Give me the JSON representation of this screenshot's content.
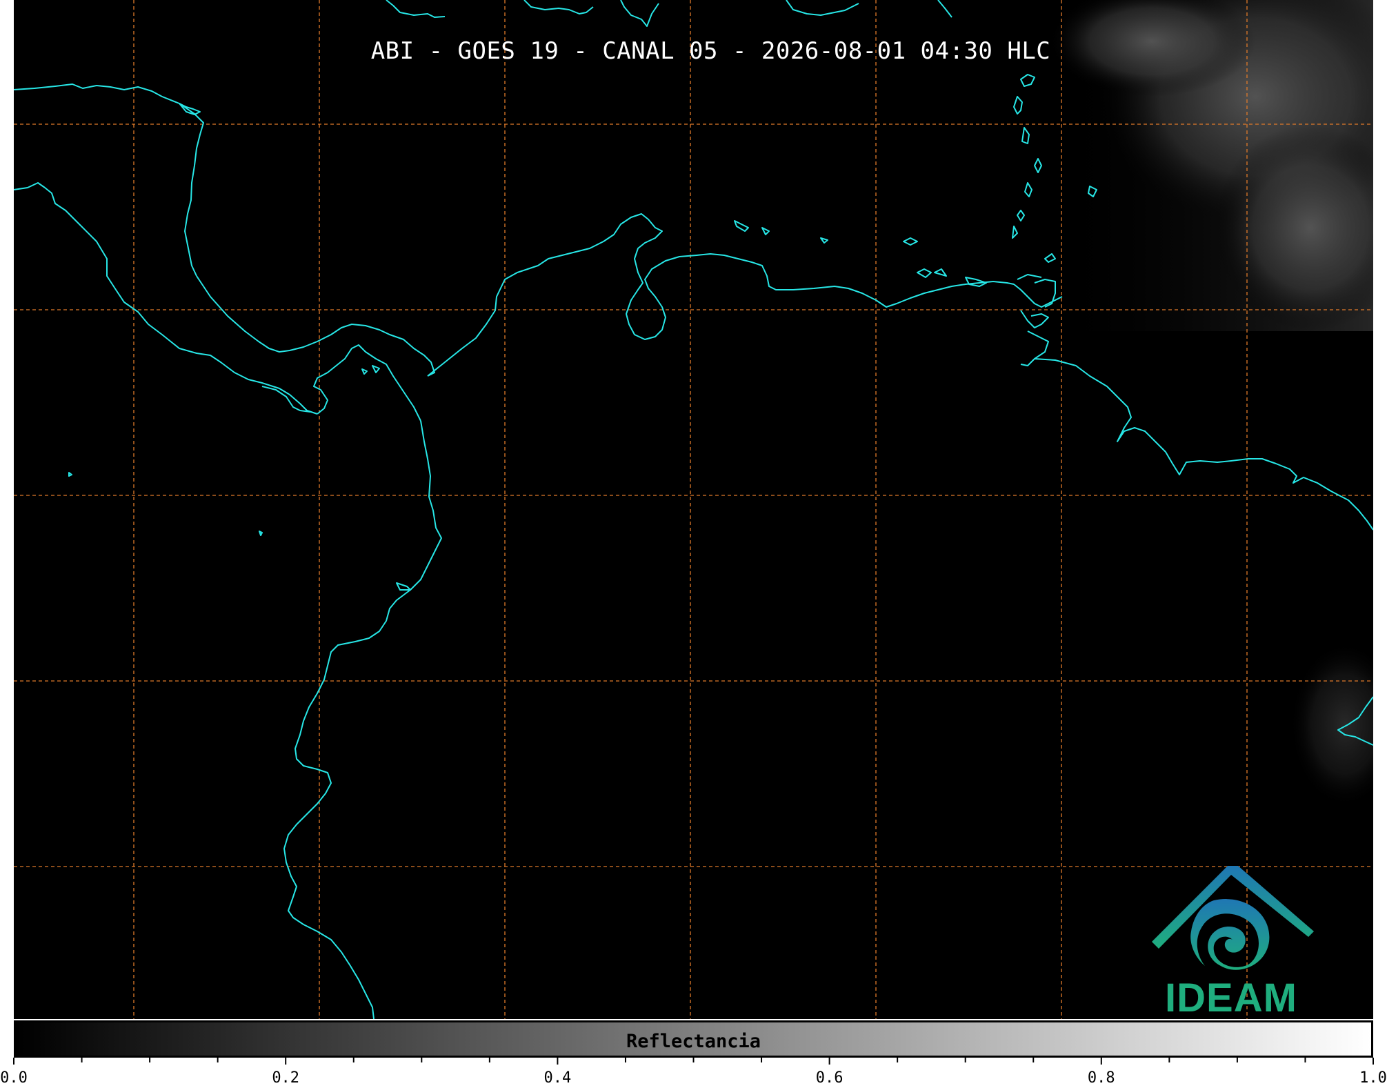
{
  "map": {
    "title": "ABI - GOES 19 - CANAL 05 - 2026-08-01 04:30 HLC",
    "background_color": "#000000",
    "coastline_color": "#27e6e6",
    "gridline_color": "#e07a2a",
    "grid": true,
    "logo": {
      "text": "IDEAM",
      "icon": "ideam-logo-icon",
      "colors": [
        "#1f77b4",
        "#1fae7e"
      ]
    }
  },
  "colorbar": {
    "label": "Reflectancia",
    "range": [
      0.0,
      1.0
    ],
    "colormap": "gray",
    "tick_labels": [
      "0.0",
      "0.2",
      "0.4",
      "0.6",
      "0.8",
      "1.0"
    ],
    "major_ticks": [
      0.0,
      0.2,
      0.4,
      0.6,
      0.8,
      1.0
    ],
    "minor_step": 0.05
  }
}
